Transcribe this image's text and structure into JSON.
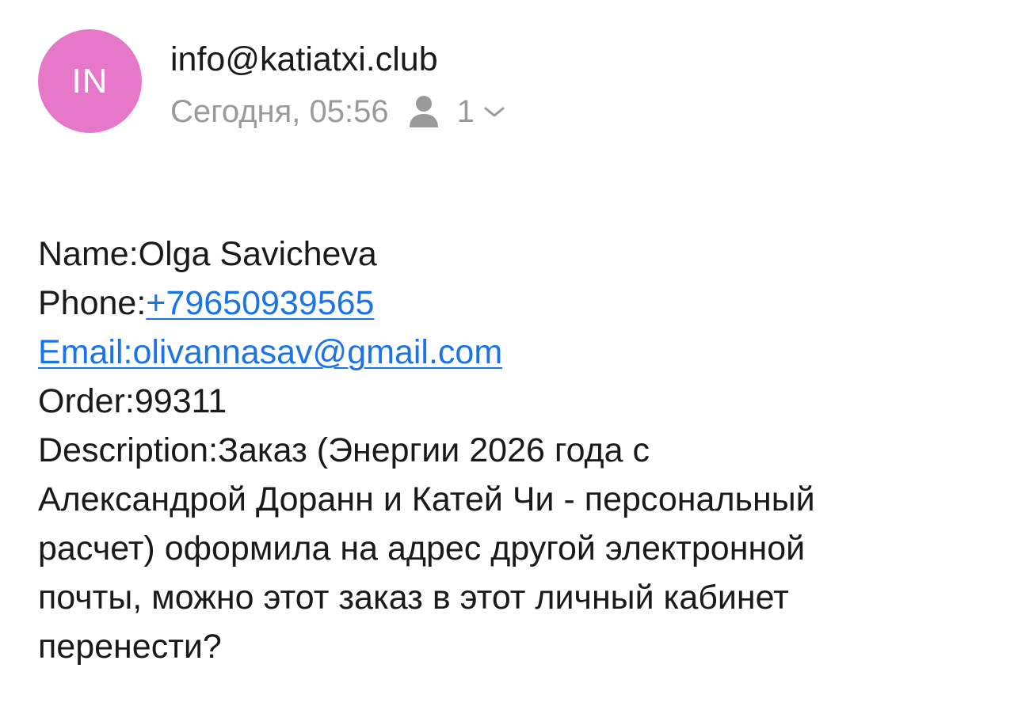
{
  "header": {
    "avatar_initials": "IN",
    "avatar_color": "#e778c9",
    "sender": "info@katiatxi.club",
    "date": "Сегодня, 05:56",
    "recipient_count": "1",
    "recipient_icon": "person-icon",
    "expand_icon": "chevron-down-icon"
  },
  "message": {
    "name_label": "Name:",
    "name_value": "Olga Savicheva",
    "phone_label": "Phone:",
    "phone_value": "+79650939565",
    "email_line": "Email:olivannasav@gmail.com",
    "order_label": "Order:",
    "order_value": "99311",
    "description_label": "Description:",
    "description_lines": [
      "Заказ (Энергии 2026 года с",
      "Александрой Доранн и Катей Чи - персональный",
      "расчет) оформила на адрес другой электронной",
      "почты, можно этот заказ в этот личный кабинет",
      "перенести?"
    ]
  },
  "colors": {
    "link": "#1a73e8",
    "meta_text": "#9a9a9a",
    "text": "#1a1a1a"
  }
}
